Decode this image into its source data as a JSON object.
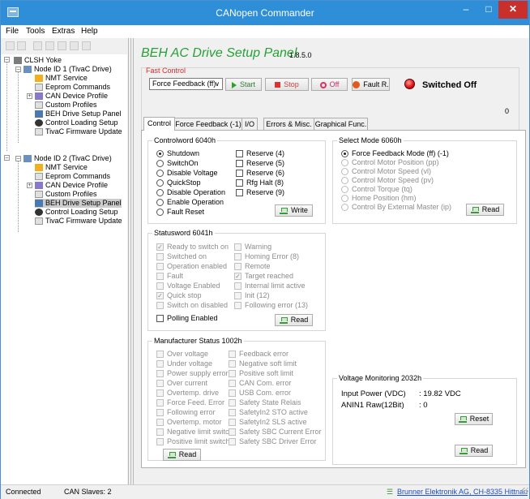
{
  "window": {
    "title": "CANopen Commander",
    "min": "–",
    "max": "□",
    "close": "✕"
  },
  "menu": [
    "File",
    "Tools",
    "Extras",
    "Help"
  ],
  "tree": [
    {
      "label": "CLSH Yoke",
      "icon": "yoke-icon"
    },
    {
      "label": "Node ID 1 (TivaC Drive)",
      "icon": "node-icon"
    },
    {
      "label": "NMT Service",
      "icon": "lightning-icon"
    },
    {
      "label": "Eeprom Commands",
      "icon": "document-icon"
    },
    {
      "label": "CAN Device Profile",
      "icon": "profile-icon"
    },
    {
      "label": "Custom Profiles",
      "icon": "document-icon"
    },
    {
      "label": "BEH Drive Setup Panel",
      "icon": "gears-icon"
    },
    {
      "label": "Control Loading Setup",
      "icon": "gauge-icon"
    },
    {
      "label": "TivaC Firmware Update",
      "icon": "document-icon"
    },
    {
      "label": "Node ID 2 (TivaC Drive)",
      "icon": "node-icon"
    },
    {
      "label": "NMT Service",
      "icon": "lightning-icon"
    },
    {
      "label": "Eeprom Commands",
      "icon": "document-icon"
    },
    {
      "label": "CAN Device Profile",
      "icon": "profile-icon"
    },
    {
      "label": "Custom Profiles",
      "icon": "document-icon"
    },
    {
      "label": "BEH Drive Setup Panel",
      "icon": "gears-icon"
    },
    {
      "label": "Control Loading Setup",
      "icon": "gauge-icon"
    },
    {
      "label": "TivaC Firmware Update",
      "icon": "document-icon"
    }
  ],
  "panel": {
    "title": "BEH AC Drive Setup Panel",
    "version": "1.8.5.0"
  },
  "fast_control": {
    "label": "Fast Control",
    "mode": "Force Feedback (ff)",
    "start": "Start",
    "stop": "Stop",
    "off": "Off",
    "fault_reset": "Fault R.",
    "status": "Switched Off",
    "status_color": "#d81010",
    "counter": "0"
  },
  "tabs": [
    "Control",
    "Force Feedback (-1)",
    "I/O",
    "Errors & Misc.",
    "Graphical Func."
  ],
  "controlword": {
    "title": "Controlword 6040h",
    "radios": [
      "Shutdown",
      "SwitchOn",
      "Disable Voltage",
      "QuickStop",
      "Disable Operation",
      "Enable Operation",
      "Fault Reset"
    ],
    "selected_radio": "Shutdown",
    "checks": [
      "Reserve (4)",
      "Reserve (5)",
      "Reserve (6)",
      "Rfg Halt (8)",
      "Reserve (9)"
    ],
    "write": "Write"
  },
  "select_mode": {
    "title": "Select Mode 6060h",
    "options": [
      "Force Feedback Mode (ff) (-1)",
      "Control Motor Position (pp)",
      "Control Motor Speed (vl)",
      "Control Motor Speed (pv)",
      "Control Torque (tq)",
      "Home Position (hm)",
      "Control By External Master (ip)"
    ],
    "selected": "Force Feedback Mode (ff) (-1)",
    "read": "Read"
  },
  "statusword": {
    "title": "Statusword 6041h",
    "left": [
      {
        "label": "Ready to switch on",
        "checked": true
      },
      {
        "label": "Switched on",
        "checked": false
      },
      {
        "label": "Operation enabled",
        "checked": false
      },
      {
        "label": "Fault",
        "checked": false
      },
      {
        "label": "Voltage Enabled",
        "checked": false
      },
      {
        "label": "Quick stop",
        "checked": true
      },
      {
        "label": "Switch on disabled",
        "checked": false
      }
    ],
    "right": [
      {
        "label": "Warning",
        "checked": false
      },
      {
        "label": "Homing Error (8)",
        "checked": false
      },
      {
        "label": "Remote",
        "checked": false
      },
      {
        "label": "Target reached",
        "checked": true
      },
      {
        "label": "Internal limit active",
        "checked": false
      },
      {
        "label": "Init (12)",
        "checked": false
      },
      {
        "label": "Following error (13)",
        "checked": false
      }
    ],
    "polling": "Polling Enabled",
    "read": "Read"
  },
  "manufacturer": {
    "title": "Manufacturer Status 1002h",
    "left": [
      "Over voltage",
      "Under voltage",
      "Power supply error",
      "Over current",
      "Overtemp. drive",
      "Force Feed. Error",
      "Following error",
      "Overtemp. motor",
      "Negative limit switch",
      "Positive limit switch"
    ],
    "right": [
      "Feedback error",
      "Negative soft limit",
      "Positive soft limit",
      "CAN Com. error",
      "USB Com. error",
      "Safety State Relais",
      "SafetyIn2 STO active",
      "SafetyIn2 SLS active",
      "Safety SBC Current Error",
      "Safety SBC Driver Error"
    ],
    "read": "Read"
  },
  "voltage": {
    "title": "Voltage Monitoring 2032h",
    "input_label": "Input Power (VDC)",
    "input_value": ": 19.82 VDC",
    "anin_label": "ANIN1 Raw(12Bit)",
    "anin_value": ": 0",
    "reset": "Reset",
    "read": "Read"
  },
  "status_bar": {
    "connected": "Connected",
    "slaves": "CAN Slaves: 2",
    "company": "Brunner Elektronik AG, CH-8335 Hittnau"
  }
}
